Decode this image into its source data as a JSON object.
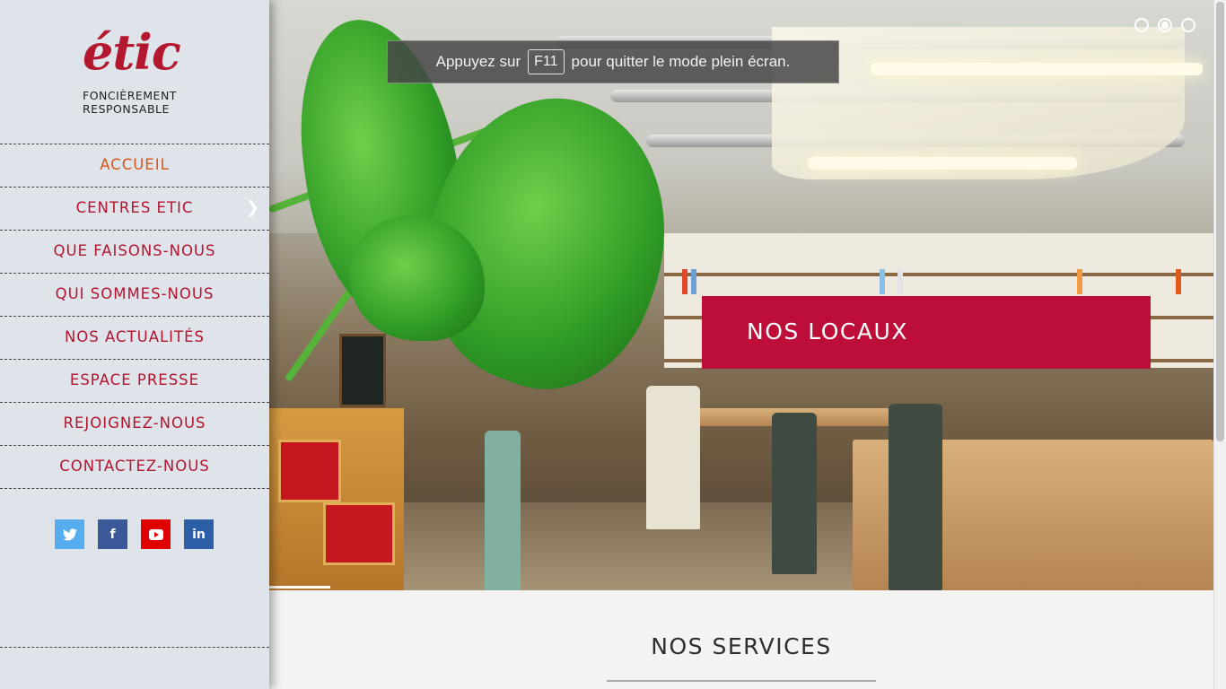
{
  "brand": {
    "logo_word": "étic",
    "tagline_line1": "FONCIÈREMENT",
    "tagline_line2": "RESPONSABLE",
    "accent_color": "#b3152f"
  },
  "nav": {
    "items": [
      {
        "label": "ACCUEIL",
        "active": true
      },
      {
        "label": "CENTRES ETIC",
        "has_submenu": true,
        "submenu_icon": "chevron-right-icon"
      },
      {
        "label": "QUE FAISONS-NOUS"
      },
      {
        "label": "QUI SOMMES-NOUS"
      },
      {
        "label": "NOS ACTUALITÉS"
      },
      {
        "label": "ESPACE PRESSE"
      },
      {
        "label": "REJOIGNEZ-NOUS"
      },
      {
        "label": "CONTACTEZ-NOUS"
      }
    ]
  },
  "social": [
    {
      "icon": "twitter-icon",
      "glyph": "🐦",
      "color": "#55acee"
    },
    {
      "icon": "facebook-icon",
      "glyph": "f",
      "color": "#3b5998"
    },
    {
      "icon": "youtube-icon",
      "glyph": "▶",
      "color": "#e00000"
    },
    {
      "icon": "linkedin-icon",
      "glyph": "in",
      "color": "#2d5ea8"
    }
  ],
  "fullscreen_notice": {
    "before": "Appuyez sur",
    "key": "F11",
    "after": "pour quitter le mode plein écran."
  },
  "slider": {
    "caption": "NOS LOCAUX",
    "caption_color": "#bd0e3a",
    "slide_count": 3,
    "active_index": 1
  },
  "services": {
    "title": "NOS SERVICES"
  }
}
